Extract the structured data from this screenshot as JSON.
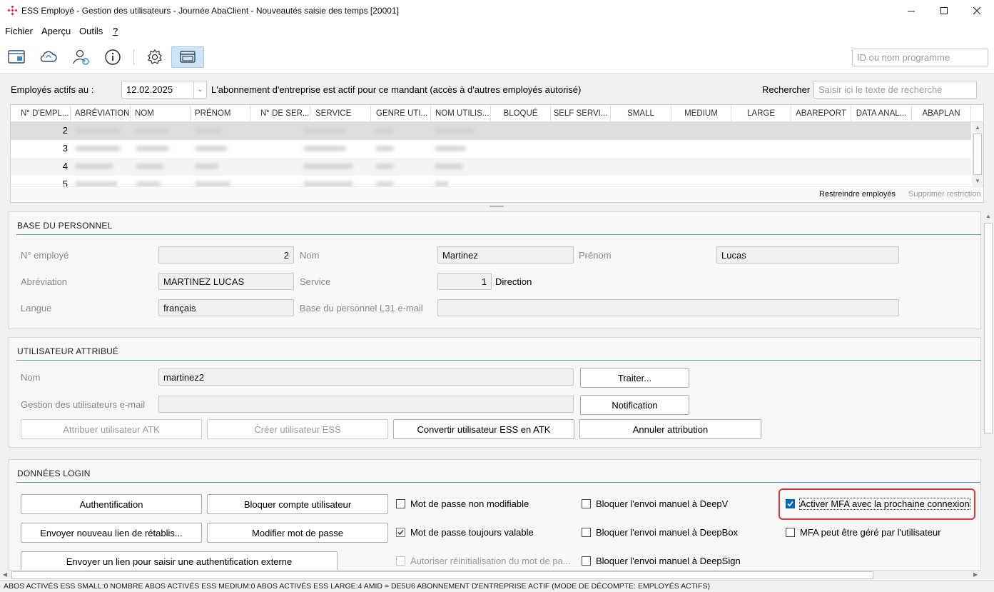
{
  "window": {
    "title": "ESS Employé - Gestion des utilisateurs - Journée AbaClient - Nouveautés saisie des temps [20001]",
    "minimize_icon": "minimize-icon",
    "maximize_icon": "maximize-icon",
    "close_icon": "close-icon"
  },
  "menu": {
    "items": [
      "Fichier",
      "Aperçu",
      "Outils",
      "?"
    ]
  },
  "toolbar": {
    "icons": [
      "form-icon",
      "cloud-sync-icon",
      "user-sync-icon",
      "info-icon",
      "settings-icon",
      "window-icon"
    ],
    "program_search_placeholder": "ID ou nom programme"
  },
  "filter": {
    "label": "Employés actifs au :",
    "date": "12.02.2025",
    "info": "L'abonnement d'entreprise est actif pour ce mandant (accès à d'autres employés autorisé)",
    "search_label": "Rechercher",
    "search_placeholder": "Saisir ici le texte de recherche"
  },
  "grid": {
    "columns": [
      "N° D'EMPL...",
      "ABRÉVIATION",
      "NOM",
      "PRÉNOM",
      "N° DE SER...",
      "SERVICE",
      "GENRE UTI...",
      "NOM UTILIS...",
      "BLOQUÉ",
      "SELF SERVI...",
      "SMALL",
      "MEDIUM",
      "LARGE",
      "ABAREPORT",
      "DATA ANAL...",
      "ABAPLAN"
    ],
    "row_numbers": [
      "2",
      "3",
      "4",
      "5"
    ],
    "restrict_link": "Restreindre employés",
    "remove_restriction_link": "Supprimer restriction"
  },
  "base_personnel": {
    "title": "BASE DU PERSONNEL",
    "employee_no_label": "N° employé",
    "employee_no": "2",
    "nom_label": "Nom",
    "nom": "Martinez",
    "prenom_label": "Prénom",
    "prenom": "Lucas",
    "abbrev_label": "Abréviation",
    "abbrev": "MARTINEZ LUCAS",
    "service_label": "Service",
    "service_no": "1",
    "service_name": "Direction",
    "langue_label": "Langue",
    "langue": "français",
    "email_label": "Base du personnel L31 e-mail",
    "email": ""
  },
  "user_assigned": {
    "title": "UTILISATEUR ATTRIBUÉ",
    "nom_label": "Nom",
    "nom": "martinez2",
    "email_label": "Gestion des utilisateurs e-mail",
    "email": "",
    "traiter_button": "Traiter...",
    "notification_button": "Notification",
    "assign_atk_button": "Attribuer utilisateur ATK",
    "create_ess_button": "Créer utilisateur ESS",
    "convert_button": "Convertir utilisateur ESS en ATK",
    "cancel_assignment_button": "Annuler attribution"
  },
  "login": {
    "title": "DONNÉES LOGIN",
    "auth_button": "Authentification",
    "block_account_button": "Bloquer compte utilisateur",
    "send_reset_link_button": "Envoyer nouveau lien de rétablis...",
    "change_password_button": "Modifier mot de passe",
    "send_external_auth_button": "Envoyer un lien pour saisir une authentification externe",
    "cb_password_not_modifiable": "Mot de passe non modifiable",
    "cb_password_always_valid": "Mot de passe toujours valable",
    "cb_allow_reset": "Autoriser réinitialisation du mot de pa...",
    "cb_block_deepv": "Bloquer l'envoi manuel à DeepV",
    "cb_block_deepbox": "Bloquer l'envoi manuel à DeepBox",
    "cb_block_deepsign": "Bloquer l'envoi manuel à DeepSign",
    "cb_activate_mfa": "Activer MFA avec la prochaine connexion",
    "cb_mfa_user_managed": "MFA peut être géré par l'utilisateur"
  },
  "status": {
    "text": "ABOS ACTIVÉS ESS SMALL:0   NOMBRE ABOS ACTIVÉS ESS MEDIUM:0   ABOS ACTIVÉS ESS LARGE:4   AMID = DE5U6   ABONNEMENT D'ENTREPRISE ACTIF (MODE DE DÉCOMPTE: EMPLOYÉS ACTIFS)"
  },
  "colors": {
    "accent": "#0067c0",
    "highlight_border": "#d9363e",
    "section_line": "#5b9bd5",
    "brand": "#d9363e"
  }
}
